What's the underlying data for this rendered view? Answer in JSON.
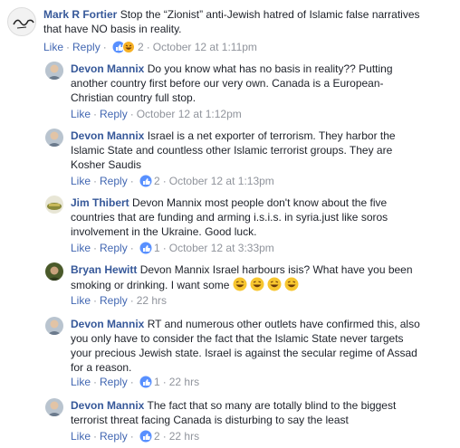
{
  "comments": [
    {
      "name": "Mark R Fortier",
      "text_lines": [
        "Stop the “Zionist” anti-Jewish hatred of Islamic false narratives",
        "that have NO basis in reality."
      ],
      "like": "Like",
      "reply": "Reply",
      "reaction_count": "2",
      "time": "October 12 at 1:11pm"
    },
    {
      "name": "Devon Mannix",
      "text_lines": [
        "Do you know what has no basis in reality?? Putting",
        "another country first before our very own. Canada is a European-",
        "Christian country full stop."
      ],
      "like": "Like",
      "reply": "Reply",
      "time": "October 12 at 1:12pm"
    },
    {
      "name": "Devon Mannix",
      "text_lines": [
        "Israel is a net exporter of terrorism. They harbor the",
        "Islamic State and countless other Islamic terrorist groups. They are",
        "Kosher Saudis"
      ],
      "like": "Like",
      "reply": "Reply",
      "reaction_count": "2",
      "time": "October 12 at 1:13pm"
    },
    {
      "name": "Jim Thibert",
      "text_lines": [
        "Devon Mannix most people don't know about the five",
        "countries that are funding and arming i.s.i.s. in syria.just like soros",
        "involvement in the Ukraine. Good luck."
      ],
      "like": "Like",
      "reply": "Reply",
      "reaction_count": "1",
      "time": "October 12 at 3:33pm"
    },
    {
      "name": "Bryan Hewitt",
      "text_lines": [
        "Devon Mannix Israel harbours isis? What have you been",
        "smoking or drinking. I want some"
      ],
      "like": "Like",
      "reply": "Reply",
      "time": "22 hrs"
    },
    {
      "name": "Devon Mannix",
      "text_lines": [
        "RT and numerous other outlets have confirmed this, also",
        "you only have to consider the fact that the Islamic State never targets",
        "your precious Jewish state. Israel is against the secular regime of Assad",
        "for a reason."
      ],
      "like": "Like",
      "reply": "Reply",
      "reaction_count": "1",
      "time": "22 hrs"
    },
    {
      "name": "Devon Mannix",
      "text_lines": [
        "The fact that so many are totally blind to the biggest",
        "terrorist threat facing Canada is disturbing to say the least"
      ],
      "like": "Like",
      "reply": "Reply",
      "reaction_count": "2",
      "time": "22 hrs"
    }
  ],
  "colors": {
    "link": "#4267b2",
    "name": "#365899",
    "meta": "#90949c",
    "like_blue": "#5890ff",
    "haha_yellow": "#f7b125"
  }
}
